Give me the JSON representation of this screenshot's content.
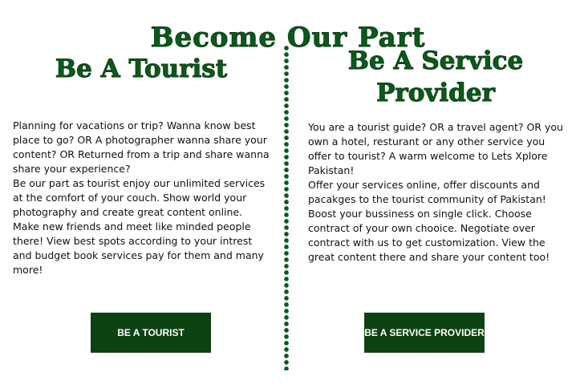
{
  "page": {
    "title": "Become Our Part"
  },
  "tourist": {
    "title": "Be A Tourist",
    "description": "Planning for vacations or trip? Wanna know best place to go? OR A photographer wanna share your content? OR Returned from a trip and share wanna share your experience?\nBe our part as tourist enjoy our unlimited services at the comfort of your couch. Show world your photography and create great content online. Make new friends and meet like minded people there! View best spots according to your intrest and budget book services pay for them and many more!",
    "button_label": "BE A TOURIST"
  },
  "provider": {
    "title": "Be A Service Provider",
    "description": "You are a tourist guide? OR a travel agent? OR you own a hotel, resturant or any other service you offer to tourist? A warm welcome to Let́s Xplore Pakistan!\nOffer your services online, offer discounts and pacakges to the tourist community of Pakistan! Boost your bussiness on single click. Choose contract of your own chooice. Negotiate over contract with us to get customization. View the great content there and share your content too!",
    "button_label": "BE A SERVICE PROVIDER"
  },
  "colors": {
    "accent": "#0a5a1c",
    "button_bg": "#0d4213",
    "button_text": "#ffffff"
  }
}
